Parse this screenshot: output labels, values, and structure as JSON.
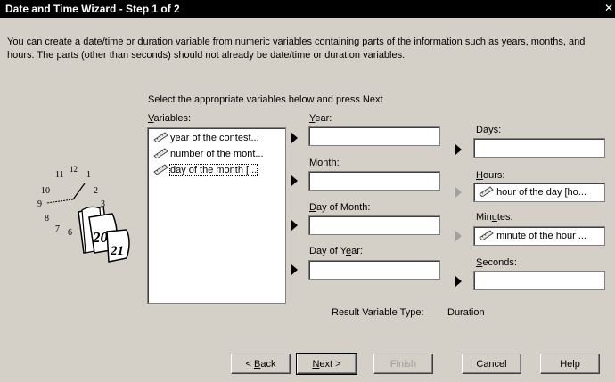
{
  "window": {
    "title": "Date and Time Wizard - Step 1 of 2",
    "close_glyph": "✕"
  },
  "description": "You can create a date/time or duration variable from numeric variables containing parts of the information such as years, months, and hours. The parts (other than seconds) should not already be date/time or duration variables.",
  "instruction": "Select the appropriate variables below and press Next",
  "variables": {
    "label_accel": "V",
    "label_rest": "ariables:",
    "items": [
      {
        "label": "year of the contest..."
      },
      {
        "label": "number of the mont..."
      },
      {
        "label": "day of the month [..."
      }
    ]
  },
  "fields": {
    "year": {
      "label_accel": "Y",
      "label_rest": "ear:",
      "value": ""
    },
    "month": {
      "label_accel": "M",
      "label_rest": "onth:",
      "value": ""
    },
    "day_of_month": {
      "label_accel": "D",
      "label_rest": "ay of Month:",
      "value": ""
    },
    "day_of_year": {
      "label_pre": "Day of Y",
      "label_accel": "e",
      "label_rest": "ar:",
      "value": ""
    },
    "days": {
      "label_pre": "Da",
      "label_accel": "y",
      "label_rest": "s:",
      "value": ""
    },
    "hours": {
      "label_accel": "H",
      "label_rest": "ours:",
      "value": "hour of the day [ho..."
    },
    "minutes": {
      "label_pre": "Min",
      "label_accel": "u",
      "label_rest": "tes:",
      "value": "minute of the hour ..."
    },
    "seconds": {
      "label_accel": "S",
      "label_rest": "econds:",
      "value": ""
    }
  },
  "result": {
    "label": "Result Variable Type:",
    "value": "Duration"
  },
  "illustration": {
    "clock_numbers": [
      "11",
      "12",
      "1",
      "10",
      "2",
      "9",
      "3",
      "8",
      "7",
      "6"
    ],
    "calendar_numbers": [
      "20",
      "21"
    ]
  },
  "buttons": {
    "back": {
      "pre": "< ",
      "accel": "B",
      "rest": "ack"
    },
    "next": {
      "accel": "N",
      "rest": "ext >"
    },
    "finish": "Finish",
    "cancel": "Cancel",
    "help": "Help"
  },
  "colors": {
    "title_bar": "#000000",
    "dialog_bg": "#d4d0c8",
    "field_bg": "#ffffff",
    "disabled_text": "#a0a0a0"
  },
  "icons": {
    "variable_type": "ruler-icon",
    "move_arrow": "right-triangle-arrow-icon"
  }
}
